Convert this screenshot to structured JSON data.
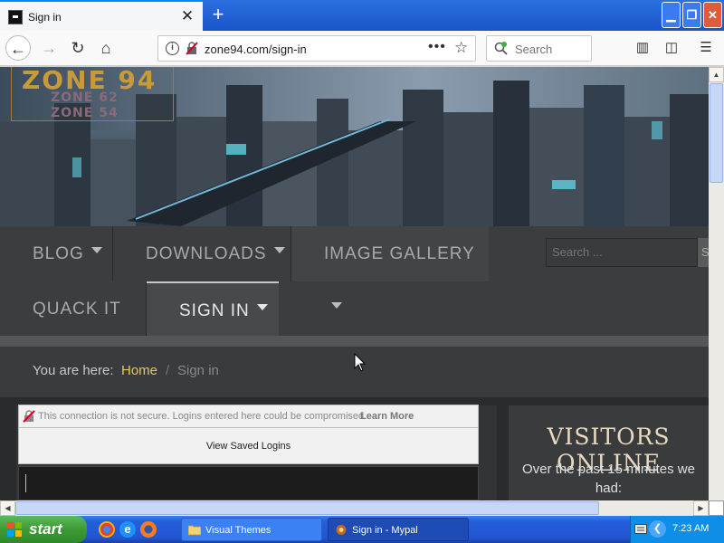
{
  "browser": {
    "tab_title": "Sign in",
    "url": "zone94.com/sign-in",
    "search_placeholder": "Search",
    "colors": {
      "accent": "#0a84ff",
      "titlebar": "#245edb"
    }
  },
  "site": {
    "logo_main": "ZONE 94",
    "logo_sub1": "ZONE 62",
    "logo_sub2": "ZONE 54",
    "nav": [
      {
        "label": "BLOG"
      },
      {
        "label": "DOWNLOADS"
      },
      {
        "label": "IMAGE GALLERY"
      },
      {
        "label": "QUACK IT"
      },
      {
        "label": "SIGN IN"
      }
    ],
    "search_placeholder": "Search ...",
    "search_button": "S",
    "breadcrumb": {
      "prefix": "You are here:",
      "home": "Home",
      "separator": "/",
      "current": "Sign in"
    },
    "insecure_warning": {
      "message": "This connection is not secure. Logins entered here could be compromised.",
      "link": "Learn More"
    },
    "saved_logins": "View Saved Logins",
    "sidebar": {
      "title": "VISITORS ONLINE",
      "text": "Over the past 15 minutes we had:"
    },
    "colors": {
      "gold": "#e6c46a",
      "nav_bg": "#3c3d3f"
    }
  },
  "taskbar": {
    "start_label": "start",
    "tasks": [
      {
        "label": "Visual Themes"
      },
      {
        "label": "Sign in - Mypal"
      }
    ],
    "clock": "7:23 AM"
  }
}
